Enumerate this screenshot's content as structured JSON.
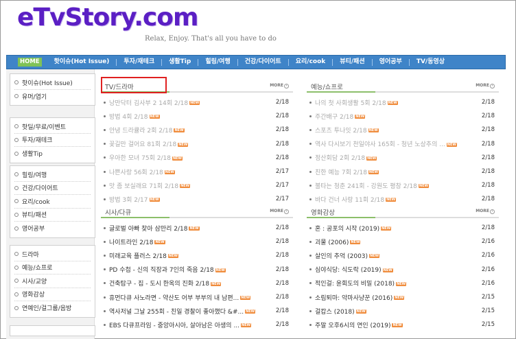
{
  "site": {
    "logo": "eTvStory.com",
    "tagline": "Relax, Enjoy. That's all you have to do"
  },
  "nav": {
    "items": [
      "HOME",
      "핫이슈(Hot Issue)",
      "투자/재테크",
      "생활Tip",
      "힐링/여행",
      "건강/다이어트",
      "요리/cook",
      "뷰티/패션",
      "영어공부",
      "TV/동영상"
    ]
  },
  "sidebar": {
    "groups": [
      [
        "핫이슈(Hot Issue)",
        "유머/엽기"
      ],
      [
        "핫딜/무료/이벤트",
        "투자/재테크",
        "생활Tip"
      ],
      [
        "힐링/여행",
        "건강/다이어트",
        "요리/cook",
        "뷰티/패션",
        "영어공부"
      ],
      [
        "드라마",
        "예능/쇼프로",
        "시사/교양",
        "영화감상",
        "연예인/걸그룹/음방"
      ]
    ]
  },
  "more_label": "MORE",
  "new_label": "NEW",
  "sections": [
    {
      "title": "TV/드라마",
      "rows": [
        {
          "t": "낭만닥터 김사부 2 14회 2/18",
          "d": "2/18",
          "dim": true
        },
        {
          "t": "방법 4회 2/18",
          "d": "2/18",
          "dim": true
        },
        {
          "t": "안녕 드라큘라 2회 2/18",
          "d": "2/18",
          "dim": true
        },
        {
          "t": "꽃길만 걸어요 81회 2/18",
          "d": "2/18",
          "dim": true
        },
        {
          "t": "우아한 모녀 75회 2/18",
          "d": "2/18",
          "dim": true
        },
        {
          "t": "나쁜사랑 56회 2/18",
          "d": "2/17",
          "dim": true
        },
        {
          "t": "맛 좀 보실래요 71회 2/18",
          "d": "2/17",
          "dim": true
        },
        {
          "t": "방법 3회 2/17",
          "d": "2/17",
          "dim": true
        }
      ]
    },
    {
      "title": "예능/쇼프로",
      "rows": [
        {
          "t": "나의 첫 사회생활 5회 2/18",
          "d": "2/18",
          "dim": true
        },
        {
          "t": "주간배구 2/18",
          "d": "2/18",
          "dim": true
        },
        {
          "t": "스포츠 투나잇 2/18",
          "d": "2/18",
          "dim": true
        },
        {
          "t": "역사 다시보기 천일야사 165회 - 청년 노상추의 ...",
          "d": "2/18",
          "dim": true
        },
        {
          "t": "정산회담 2회 2/18",
          "d": "2/18",
          "dim": true
        },
        {
          "t": "친한 예능 7회 2/18",
          "d": "2/18",
          "dim": true
        },
        {
          "t": "불타는 청춘 241회 - 강원도 평창 2/18",
          "d": "2/18",
          "dim": true
        },
        {
          "t": "바다 건너 사랑 11회 2/18",
          "d": "2/18",
          "dim": true
        }
      ]
    },
    {
      "title": "시사/다큐",
      "rows": [
        {
          "t": "글로벌 아빠 찾아 삼만리 2/18",
          "d": "2/18",
          "dim": false
        },
        {
          "t": "나이트라인 2/18",
          "d": "2/18",
          "dim": false
        },
        {
          "t": "미래교육 플러스 2/18",
          "d": "2/18",
          "dim": false
        },
        {
          "t": "PD 수첩 - 신의 직장과 7인의 죽음 2/18",
          "d": "2/18",
          "dim": false
        },
        {
          "t": "건축탐구 - 집 - 도시 한옥의 진화 2/18",
          "d": "2/18",
          "dim": false
        },
        {
          "t": "휴먼다큐 사노라면 - 약산도 어부 부부의 내 남편...",
          "d": "2/18",
          "dim": false
        },
        {
          "t": "역사저널 그날 255회 - 친일 경찰이 좋아했다 &#...",
          "d": "2/18",
          "dim": false
        },
        {
          "t": "EBS 다큐프라임 - 중앙아시아, 살아남은 아생의 ...",
          "d": "2/18",
          "dim": false
        }
      ]
    },
    {
      "title": "영화감상",
      "rows": [
        {
          "t": "혼 : 공포의 시작 (2019)",
          "d": "2/18",
          "dim": false
        },
        {
          "t": "괴물 (2006)",
          "d": "2/16",
          "dim": false
        },
        {
          "t": "살인의 추억 (2003)",
          "d": "2/16",
          "dim": false
        },
        {
          "t": "심야식당: 식도락 (2019)",
          "d": "2/16",
          "dim": false
        },
        {
          "t": "적인걸: 윤회도의 비밀 (2018)",
          "d": "2/16",
          "dim": false
        },
        {
          "t": "소림퇴마: 악마사냥꾼 (2016)",
          "d": "2/15",
          "dim": false
        },
        {
          "t": "걸캅스 (2018)",
          "d": "2/15",
          "dim": false
        },
        {
          "t": "주말 오후6시의 연인 (2019)",
          "d": "2/15",
          "dim": false
        }
      ]
    }
  ]
}
